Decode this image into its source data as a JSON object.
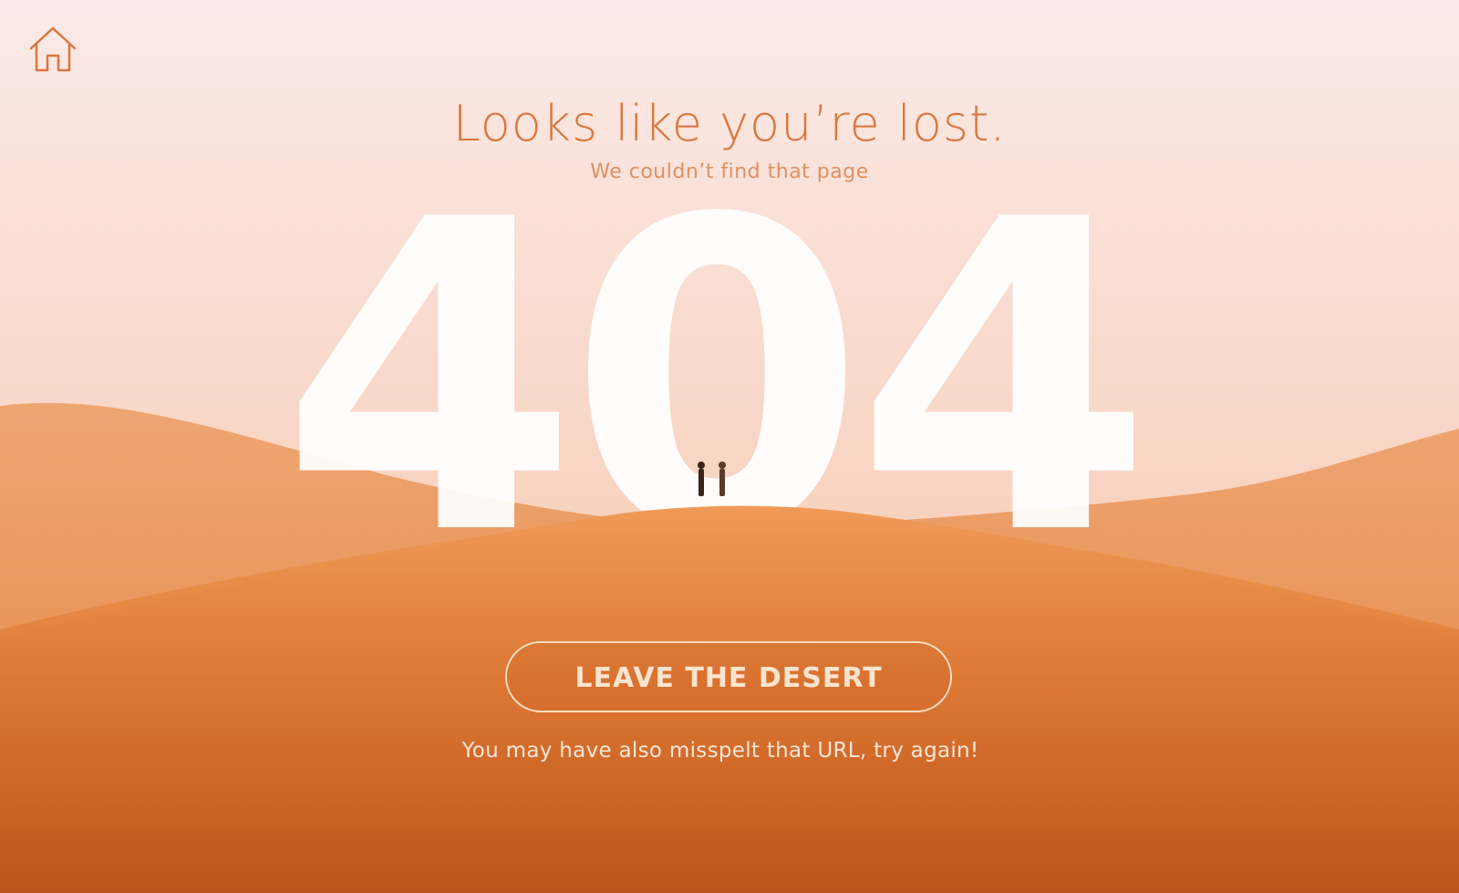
{
  "nav": {
    "home_icon": "home-icon"
  },
  "message": {
    "title": "Looks like you’re lost.",
    "subtitle": "We couldn’t find that page",
    "error_code": "404"
  },
  "actions": {
    "leave_label": "LEAVE THE DESERT",
    "hint": "You may have also misspelt that URL, try again!"
  },
  "colors": {
    "accent": "#d9773e",
    "sand": "#e8894b",
    "sky": "#fbe8e6",
    "button_border": "#f6dcc4"
  }
}
